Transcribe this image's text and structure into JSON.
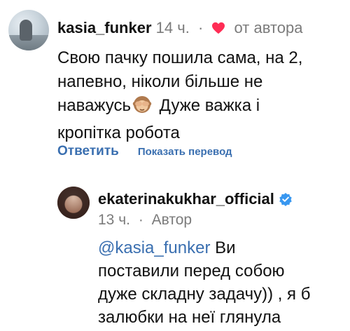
{
  "comment1": {
    "username": "kasia_funker",
    "time": "14 ч.",
    "separator": "·",
    "liked_by_author": "от автора",
    "body_lines": [
      "Свою пачку пошила сама, на 2,",
      "напевно, ніколи більше не",
      "наважусь",
      " Дуже важка і",
      "кропітка робота"
    ],
    "reply_label": "Ответить",
    "translate_label": "Показать перевод"
  },
  "comment2": {
    "username": "ekaterinakukhar_official",
    "time": "13 ч.",
    "separator": "·",
    "author_label": "Автор",
    "mention": "@kasia_funker",
    "body_lines": [
      " Ви",
      "поставили перед собою",
      "дуже складну задачу)) , я б",
      "залюбки на неї глянула"
    ]
  },
  "colors": {
    "heart": "#ff2d55",
    "link": "#3a6fb0",
    "muted": "#7b7b7b",
    "verified": "#3897f0"
  },
  "icons": {
    "heart": "heart-icon",
    "emoji": "see-no-evil-monkey-emoji",
    "verified": "verified-badge-icon"
  }
}
